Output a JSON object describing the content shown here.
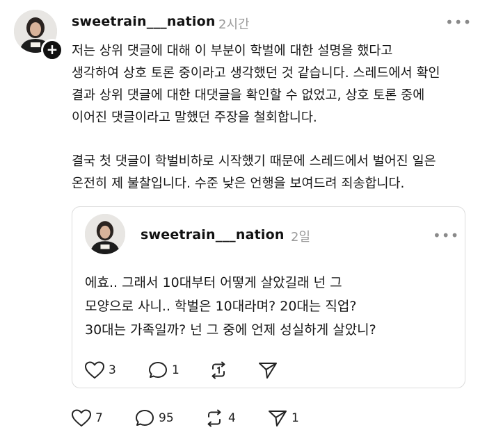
{
  "post": {
    "username": "sweetrain___nation",
    "time": "2시간",
    "more": "•••",
    "paragraph1": "저는 상위 댓글에 대해 이 부분이 학벌에 대한 설명을 했다고\n생각하여 상호 토론 중이라고 생각했던 것 같습니다. 스레드에서 확인\n결과 상위 댓글에 대한 대댓글을 확인할 수 없었고,  상호 토론 중에\n이어진 댓글이라고 말했던 주장을 철회합니다.",
    "paragraph2": "결국 첫 댓글이 학벌비하로 시작했기 때문에 스레드에서 벌어진 일은\n온전히 제 불찰입니다. 수준 낮은 언행을 보여드려 죄송합니다.",
    "actions": {
      "likes": "7",
      "comments": "95",
      "reposts": "4",
      "shares": "1"
    }
  },
  "quote": {
    "username": "sweetrain___nation",
    "time": "2일",
    "more": "•••",
    "text": "에효.. 그래서 10대부터 어떻게 살았길래 넌 그\n모양으로 사니.. 학벌은 10대라며? 20대는 직업?\n30대는 가족일까? 넌 그 중에 언제 성실하게 살았니?",
    "actions": {
      "likes": "3",
      "comments": "1"
    }
  },
  "icons": {
    "like": "heart-icon",
    "comment": "comment-bubble-icon",
    "repost": "repost-icon",
    "share": "send-icon",
    "follow": "plus-icon",
    "more": "more-dots-icon"
  }
}
